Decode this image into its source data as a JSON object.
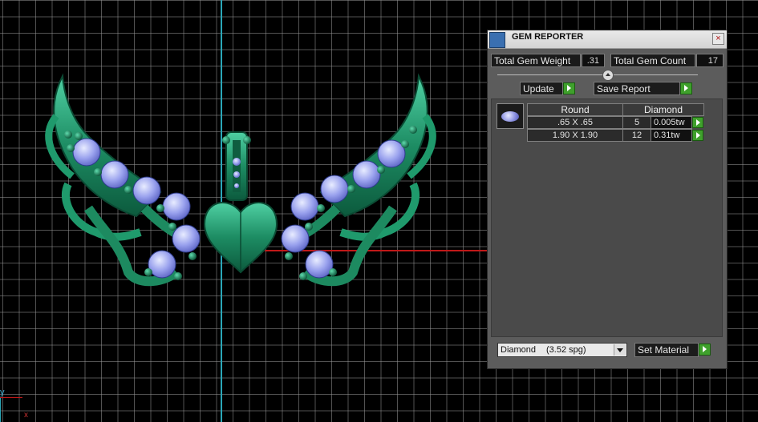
{
  "viewport": {
    "axis_x_label": "x",
    "axis_y_label": "y"
  },
  "panel": {
    "title": "GEM REPORTER",
    "close_glyph": "×",
    "total_weight_label": "Total Gem Weight",
    "total_weight_value": ".31",
    "total_count_label": "Total Gem Count",
    "total_count_value": "17",
    "update_label": "Update",
    "save_report_label": "Save Report",
    "table": {
      "shape_header": "Round",
      "material_header": "Diamond",
      "rows": [
        {
          "size": ".65 X .65",
          "count": "5",
          "weight": "0.005tw"
        },
        {
          "size": "1.90 X 1.90",
          "count": "12",
          "weight": "0.31tw"
        }
      ]
    },
    "material": {
      "name": "Diamond",
      "spg": "(3.52 spg)"
    },
    "set_material_label": "Set Material"
  },
  "colors": {
    "pendant_metal": "#1f8a63",
    "gem": "#8f98e8",
    "go_button": "#3fa02c",
    "axis_y": "#2aa7b8",
    "axis_x": "#c01818"
  },
  "icons": {
    "app": "gem-reporter-icon",
    "close": "close-icon",
    "go": "play-arrow-icon",
    "dropdown": "chevron-down-icon"
  }
}
